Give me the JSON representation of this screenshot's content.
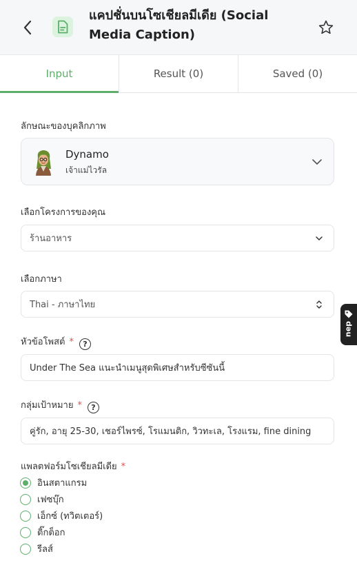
{
  "header": {
    "title": "แคปชั่นบนโซเชียลมีเดีย (Social Media Caption)",
    "back_icon": "chevron-left-icon",
    "app_icon": "document-icon",
    "star_icon": "star-outline-icon",
    "accent": "#5cae6a"
  },
  "tabs": [
    {
      "label": "Input",
      "active": true
    },
    {
      "label": "Result (0)",
      "active": false
    },
    {
      "label": "Saved (0)",
      "active": false
    }
  ],
  "persona": {
    "label": "ลักษณะของบุคลิกภาพ",
    "name": "Dynamo",
    "subtitle": "เจ้าแม่ไวรัล"
  },
  "project": {
    "label": "เลือกโครงการของคุณ",
    "value": "ร้านอาหาร"
  },
  "language": {
    "label": "เลือกภาษา",
    "value": "Thai - ภาษาไทย"
  },
  "topic": {
    "label": "หัวข้อโพสต์",
    "required": "*",
    "help": "?",
    "value": "Under The Sea แนะนำเมนูสุดพิเศษสำหรับซีซันนี้"
  },
  "audience": {
    "label": "กลุ่มเป้าหมาย",
    "required": "*",
    "help": "?",
    "value": "คู่รัก, อายุ 25-30, เชอร์ไพรซ์, โรแมนติก, วิวทะเล, โรงแรม, fine dining"
  },
  "platform": {
    "label": "แพลตฟอร์มโซเชียลมีเดีย",
    "required": "*",
    "options": [
      {
        "label": "อินสตาแกรม",
        "checked": true
      },
      {
        "label": "เฟซบุ๊ก",
        "checked": false
      },
      {
        "label": "เอ็กซ์ (ทวิตเตอร์)",
        "checked": false
      },
      {
        "label": "ติ๊กต็อก",
        "checked": false
      },
      {
        "label": "รีลส์",
        "checked": false
      }
    ]
  },
  "side_tab": {
    "label": "dəu",
    "icon": "tag-icon"
  }
}
